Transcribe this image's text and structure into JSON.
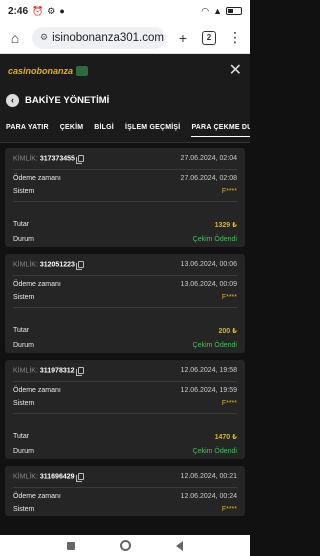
{
  "status_bar": {
    "time": "2:46",
    "battery_pct": 0.38
  },
  "browser": {
    "url": "isinobonanza301.com",
    "tabs_count": "2"
  },
  "app": {
    "logo": "casinobonanza",
    "title": "BAKİYE YÖNETİMİ"
  },
  "tabs": [
    {
      "label": "PARA YATIR"
    },
    {
      "label": "ÇEKİM"
    },
    {
      "label": "BİLGİ"
    },
    {
      "label": "İŞLEM GEÇMİŞİ"
    },
    {
      "label": "PARA ÇEKME DU"
    }
  ],
  "labels": {
    "kimlik": "KİMLİK:",
    "odeme_zamani": "Ödeme zamanı",
    "sistem": "Sistem",
    "tutar": "Tutar",
    "durum": "Durum"
  },
  "transactions": [
    {
      "id": "317373455",
      "created": "27.06.2024, 02:04",
      "paid": "27.06.2024, 02:08",
      "system": "F****",
      "amount": "1329 ₺",
      "status": "Çekim Ödendi"
    },
    {
      "id": "312051223",
      "created": "13.06.2024, 00:06",
      "paid": "13.06.2024, 00:09",
      "system": "F****",
      "amount": "200 ₺",
      "status": "Çekim Ödendi"
    },
    {
      "id": "311978312",
      "created": "12.06.2024, 19:58",
      "paid": "12.06.2024, 19:59",
      "system": "F****",
      "amount": "1470 ₺",
      "status": "Çekim Ödendi"
    },
    {
      "id": "311696429",
      "created": "12.06.2024, 00:21",
      "paid": "12.06.2024, 00:24",
      "system": "F****",
      "amount": "",
      "status": ""
    }
  ],
  "colors": {
    "accent": "#e0b31c",
    "success": "#3cc35a",
    "background": "#111111",
    "card": "#252525"
  }
}
